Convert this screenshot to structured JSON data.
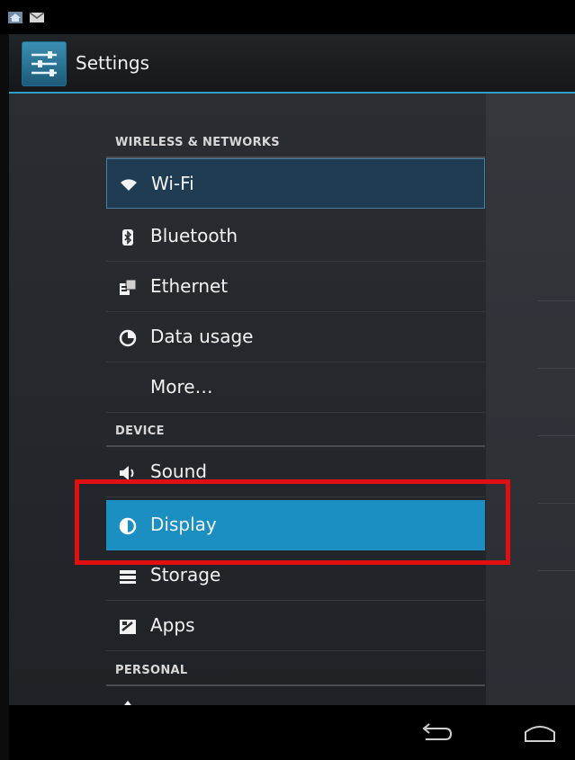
{
  "status_bar": {
    "icons": [
      "home-notification-icon",
      "gmail-icon"
    ]
  },
  "action_bar": {
    "title": "Settings",
    "app_icon": "settings-sliders-icon"
  },
  "sections": [
    {
      "header": "WIRELESS & NETWORKS"
    },
    {
      "header": "DEVICE"
    },
    {
      "header": "PERSONAL"
    }
  ],
  "items": [
    {
      "label": "Wi-Fi",
      "icon": "wifi-icon",
      "state": "focused"
    },
    {
      "label": "Bluetooth",
      "icon": "bluetooth-icon"
    },
    {
      "label": "Ethernet",
      "icon": "ethernet-icon"
    },
    {
      "label": "Data usage",
      "icon": "data-usage-icon"
    },
    {
      "label": "More…",
      "icon": ""
    },
    {
      "label": "Sound",
      "icon": "sound-icon"
    },
    {
      "label": "Display",
      "icon": "display-icon",
      "state": "selected"
    },
    {
      "label": "Storage",
      "icon": "storage-icon"
    },
    {
      "label": "Apps",
      "icon": "apps-icon"
    },
    {
      "label": "",
      "icon": "location-icon"
    }
  ],
  "nav_bar": {
    "buttons": [
      "back-icon",
      "home-icon"
    ]
  },
  "colors": {
    "accent": "#1b8fc2",
    "highlight": "#e01010",
    "action_bar_underline": "#2e9fc7"
  }
}
